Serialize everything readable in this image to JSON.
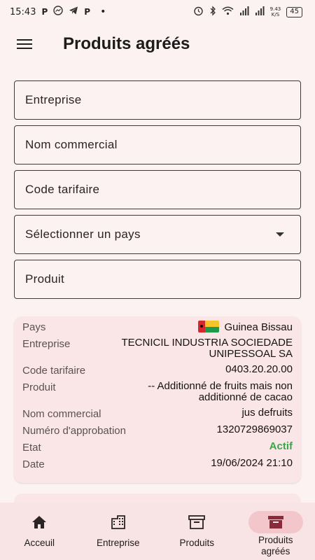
{
  "status_bar": {
    "time": "15:43",
    "left_icons": [
      "P",
      "messenger-icon",
      "telegram-icon",
      "P",
      "•"
    ],
    "speed_top": "9.43",
    "speed_bottom": "K/S",
    "battery": "45"
  },
  "app_bar": {
    "title": "Produits agréés"
  },
  "form": {
    "entreprise": "Entreprise",
    "nom_commercial": "Nom commercial",
    "code_tarifaire": "Code tarifaire",
    "pays": "Sélectionner un pays",
    "produit": "Produit"
  },
  "card": {
    "pays_label": "Pays",
    "pays_value": "Guinea Bissau",
    "entreprise_label": "Entreprise",
    "entreprise_value_line1": "TECNICIL INDUSTRIA SOCIEDADE",
    "entreprise_value_line2": "UNIPESSOAL SA",
    "code_label": "Code tarifaire",
    "code_value": "0403.20.20.00",
    "produit_label": "Produit",
    "produit_value_line1": "-- Additionné de fruits mais non",
    "produit_value_line2": "additionné de cacao",
    "nom_label": "Nom commercial",
    "nom_value": "jus defruits",
    "approbation_label": "Numéro d'approbation",
    "approbation_value": "1320729869037",
    "etat_label": "Etat",
    "etat_value": "Actif",
    "date_label": "Date",
    "date_value": "19/06/2024 21:10"
  },
  "bottom_nav": {
    "items": [
      {
        "label": "Acceuil"
      },
      {
        "label": "Entreprise"
      },
      {
        "label": "Produits"
      },
      {
        "label_line1": "Produits",
        "label_line2": "agréés"
      }
    ]
  },
  "colors": {
    "background": "#fdf2f2",
    "card": "#fbe6e7",
    "active_pill": "#f3c6cb",
    "status_active": "#3aa54a",
    "active_icon": "#8b2a3a"
  }
}
